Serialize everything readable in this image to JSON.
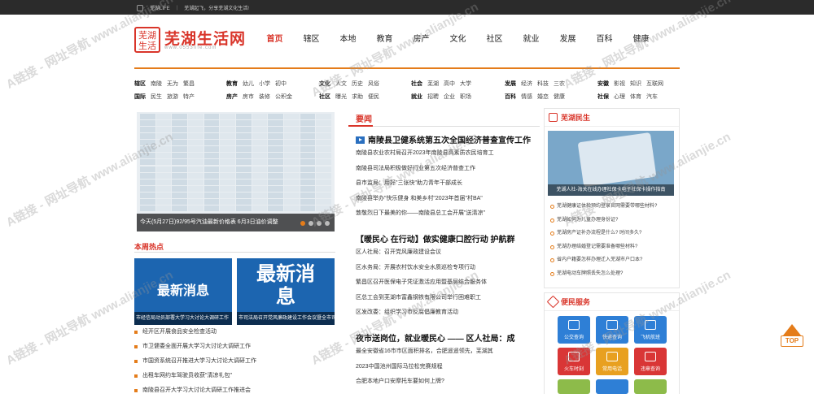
{
  "topbar": {
    "site": "芜湖LIFE",
    "slogan": "芜湖起飞，分享芜湖文化生活!"
  },
  "logo": {
    "seal_line1": "芜湖",
    "seal_line2": "生活",
    "name": "芜湖生活网",
    "url": "www.0553life.com"
  },
  "mainnav": [
    "首页",
    "辖区",
    "本地",
    "教育",
    "房产",
    "文化",
    "社区",
    "就业",
    "发展",
    "百科",
    "健康"
  ],
  "subnav": [
    {
      "row1": [
        "辖区",
        "南陵",
        "无为",
        "繁昌"
      ],
      "row2": [
        "国际",
        "民生",
        "旅游",
        "特产"
      ]
    },
    {
      "row1": [
        "教育",
        "幼儿",
        "小学",
        "初中"
      ],
      "row2": [
        "房产",
        "房市",
        "装修",
        "公积金"
      ]
    },
    {
      "row1": [
        "文化",
        "人文",
        "历史",
        "风俗"
      ],
      "row2": [
        "社区",
        "曝光",
        "求助",
        "便民"
      ]
    },
    {
      "row1": [
        "社会",
        "芜湖",
        "高中",
        "大学"
      ],
      "row2": [
        "就业",
        "招聘",
        "企业",
        "职场"
      ]
    },
    {
      "row1": [
        "发展",
        "经济",
        "科技",
        "三农"
      ],
      "row2": [
        "百科",
        "情感",
        "婚恋",
        "健康"
      ]
    },
    {
      "row1": [
        "安徽",
        "影视",
        "知识",
        "互联网"
      ],
      "row2": [
        "社保",
        "心理",
        "体育",
        "汽车"
      ]
    }
  ],
  "slider": {
    "caption": "今天(5月27日)92/95号汽油最新价格表 6月3日油价调整"
  },
  "hot": {
    "title": "本周热点",
    "thumbs": [
      {
        "big": "最新消息",
        "cap": "市经信局动员部署大学习大讨论大调研工作"
      },
      {
        "big": "最新消息",
        "cap": "市司法局召开党风廉政建设工作会议暨全市司法行政工作会"
      }
    ],
    "items": [
      "经开区开展食品安全检查活动",
      "市卫健委全面开展大学习大讨论大调研工作",
      "市国资系统召开推进大学习大讨论大调研工作",
      "出租车网约车驾驶员收获\"清凉礼包\"",
      "南陵县召开大学习大讨论大调研工作推进会"
    ]
  },
  "news": {
    "title": "要闻",
    "headline1": "南陵县卫健系统第五次全国经济普查宣传工作",
    "list1": [
      "南陵县农业农村局召开2023年南陵县高素质农民培育工",
      "南陵县司法局积极做好行业第五次经济普查工作",
      "县市监局：用好\"三张快\"助力青年干部成长",
      "南陵县举办\"快乐健身 和美乡村\"2023年首届\"村BA\"",
      "敦敬烈日下最美的你——南陵县总工会开展\"送清凉\""
    ],
    "headline2": "【暖民心 在行动】做实健康口腔行动 护航群",
    "list2": [
      "区人社局：召开党风廉政建设会议",
      "区水务局：开展农村饮水安全水质巡检专项行动",
      "繁昌区召开医保电子凭证激活应用暨基层结合服务体",
      "区总工会到芜湖市富鑫钢铁有限公司举行困难职工",
      "区发改委：组织学习市反腐倡廉教育活动"
    ],
    "headline3": "夜市送岗位，就业暖民心 —— 区人社局：成",
    "list3": [
      "最全安徽省16市市区面积排名，合肥遥遥领先，芜湖其",
      "2023中国池州国际马拉松完赛规程",
      "合肥本地户口安摩托车要如何上牌?",
      "合肥市就业补贴申请条件和流程"
    ]
  },
  "minsheng": {
    "title": "芜湖民生",
    "img_cap": "芜湖人社-海关在线办理社保卡电子社保卡操作指南",
    "items": [
      "芜湖健康证体检预约登录官网需要带哪些材料?",
      "芜湖如何为儿童办理身份证?",
      "芜湖房产证补办流程是什么? 时间多久?",
      "芜湖办理结婚登记需要准备哪些材料?",
      "省内户籍要怎样办理迁入芜湖市户口本?",
      "芜湖电动车牌照丢失怎么处理?"
    ]
  },
  "service": {
    "title": "便民服务",
    "items": [
      {
        "label": "公交查询",
        "color": "#2e7fd6"
      },
      {
        "label": "快递查询",
        "color": "#2e7fd6"
      },
      {
        "label": "飞机航班",
        "color": "#2e7fd6"
      },
      {
        "label": "火车时刻",
        "color": "#d93636"
      },
      {
        "label": "常用电话",
        "color": "#e8a020"
      },
      {
        "label": "违章查询",
        "color": "#d93636"
      }
    ]
  },
  "totop": {
    "label": "TOP"
  },
  "watermark": "A链接 - 网址导航 www.alianjie.cn"
}
